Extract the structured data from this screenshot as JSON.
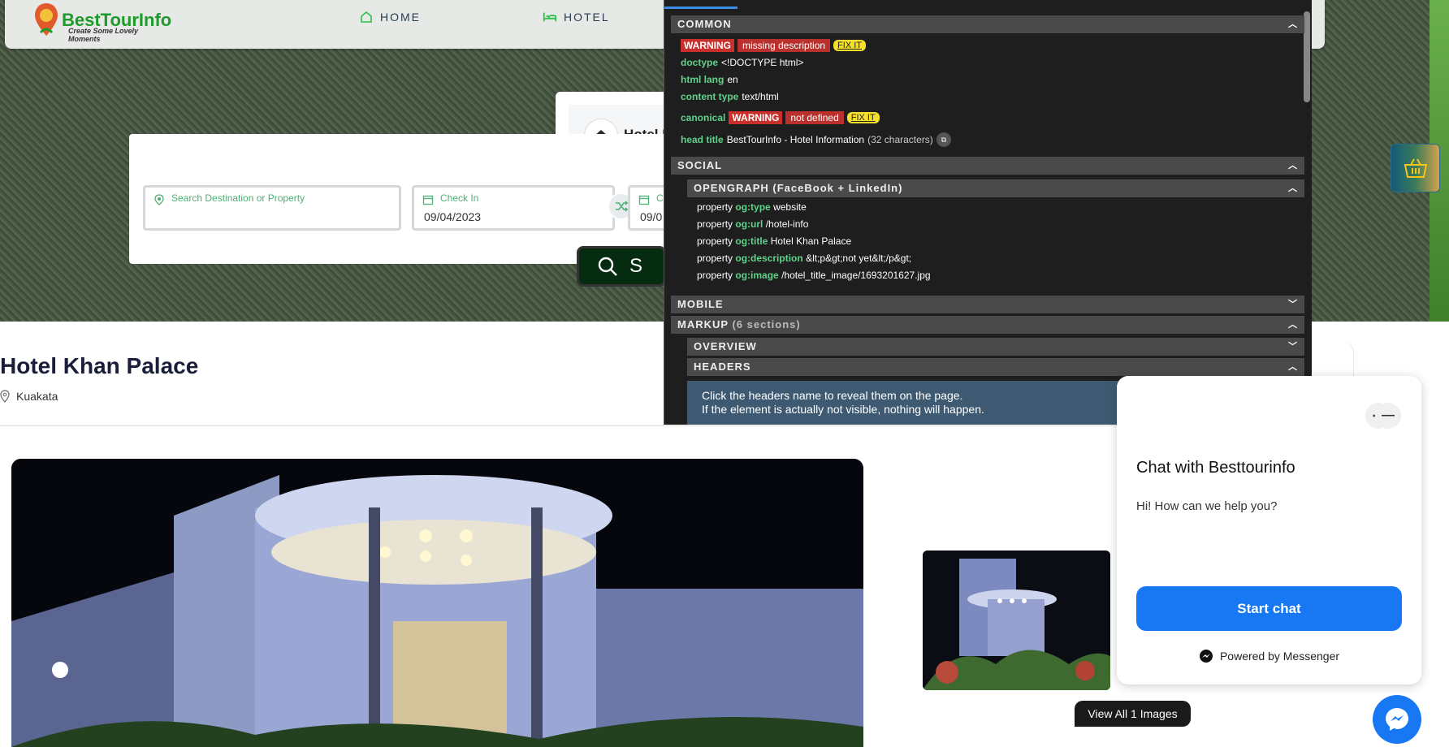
{
  "nav": {
    "logo_text": "BestTourInfo",
    "logo_tagline": "Create Some Lovely Moments",
    "items": [
      {
        "label": "HOME",
        "icon": "home-icon"
      },
      {
        "label": "HOTEL",
        "icon": "bed-icon"
      }
    ]
  },
  "search": {
    "destination_placeholder": "Search Destination or Property",
    "checkin_label": "Check In",
    "checkin_value": "09/04/2023",
    "checkout_label": "C",
    "checkout_value": "09/0",
    "button_label": "S"
  },
  "hotel_card": {
    "name": "Hotel I"
  },
  "hotel": {
    "title": "Hotel Khan Palace",
    "location": "Kuakata",
    "view_all_label": "View All 1 Images"
  },
  "devtools": {
    "common": "COMMON",
    "warning_label": "WARNING",
    "missing_description": "missing description",
    "fix_it": "FIX IT",
    "doctype_key": "doctype",
    "doctype_val": "<!DOCTYPE html>",
    "html_lang_key": "html lang",
    "html_lang_val": "en",
    "content_type_key": "content type",
    "content_type_val": "text/html",
    "canonical_key": "canonical",
    "not_defined": "not defined",
    "head_title_key": "head title",
    "head_title_val": "BestTourInfo - Hotel Information",
    "head_title_count": "(32 characters)",
    "social": "SOCIAL",
    "opengraph": "OPENGRAPH (FaceBook + LinkedIn)",
    "og_props": [
      {
        "key": "og:type",
        "val": "website"
      },
      {
        "key": "og:url",
        "val": "/hotel-info"
      },
      {
        "key": "og:title",
        "val": "Hotel Khan Palace"
      },
      {
        "key": "og:description",
        "val": "&lt;p&gt;not yet&lt;/p&gt;"
      },
      {
        "key": "og:image",
        "val": "/hotel_title_image/1693201627.jpg"
      }
    ],
    "property_label": "property",
    "mobile": "MOBILE",
    "markup": "MARKUP",
    "markup_count": "(6 sections)",
    "overview": "OVERVIEW",
    "headers": "HEADERS",
    "note_line1": "Click the headers name to reveal them on the page.",
    "note_line2": "If the element is actually not visible, nothing will happen."
  },
  "chat": {
    "title": "Chat with Besttourinfo",
    "message": "Hi! How can we help you?",
    "start_button": "Start chat",
    "powered_by": "Powered by Messenger",
    "more_icon": "more-icon",
    "minimize_icon": "minimize-icon"
  },
  "colors": {
    "accent_green": "#1f9a2c",
    "messenger_blue": "#1877f2",
    "warning_red": "#c9302c",
    "fixit_yellow": "#f5e02a"
  }
}
